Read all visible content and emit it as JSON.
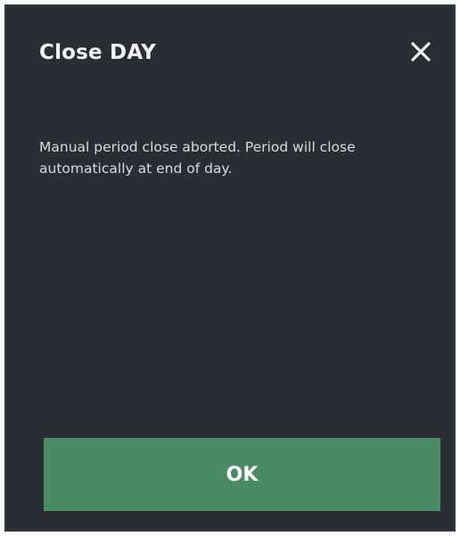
{
  "dialog": {
    "title": "Close DAY",
    "close_icon": "close-icon",
    "message": "Manual period close aborted. Period will close automatically at end of day.",
    "ok_label": "OK"
  },
  "colors": {
    "dialog_background": "#2a2d33",
    "button_background": "#4a8b63",
    "text": "#e6e6e6"
  }
}
